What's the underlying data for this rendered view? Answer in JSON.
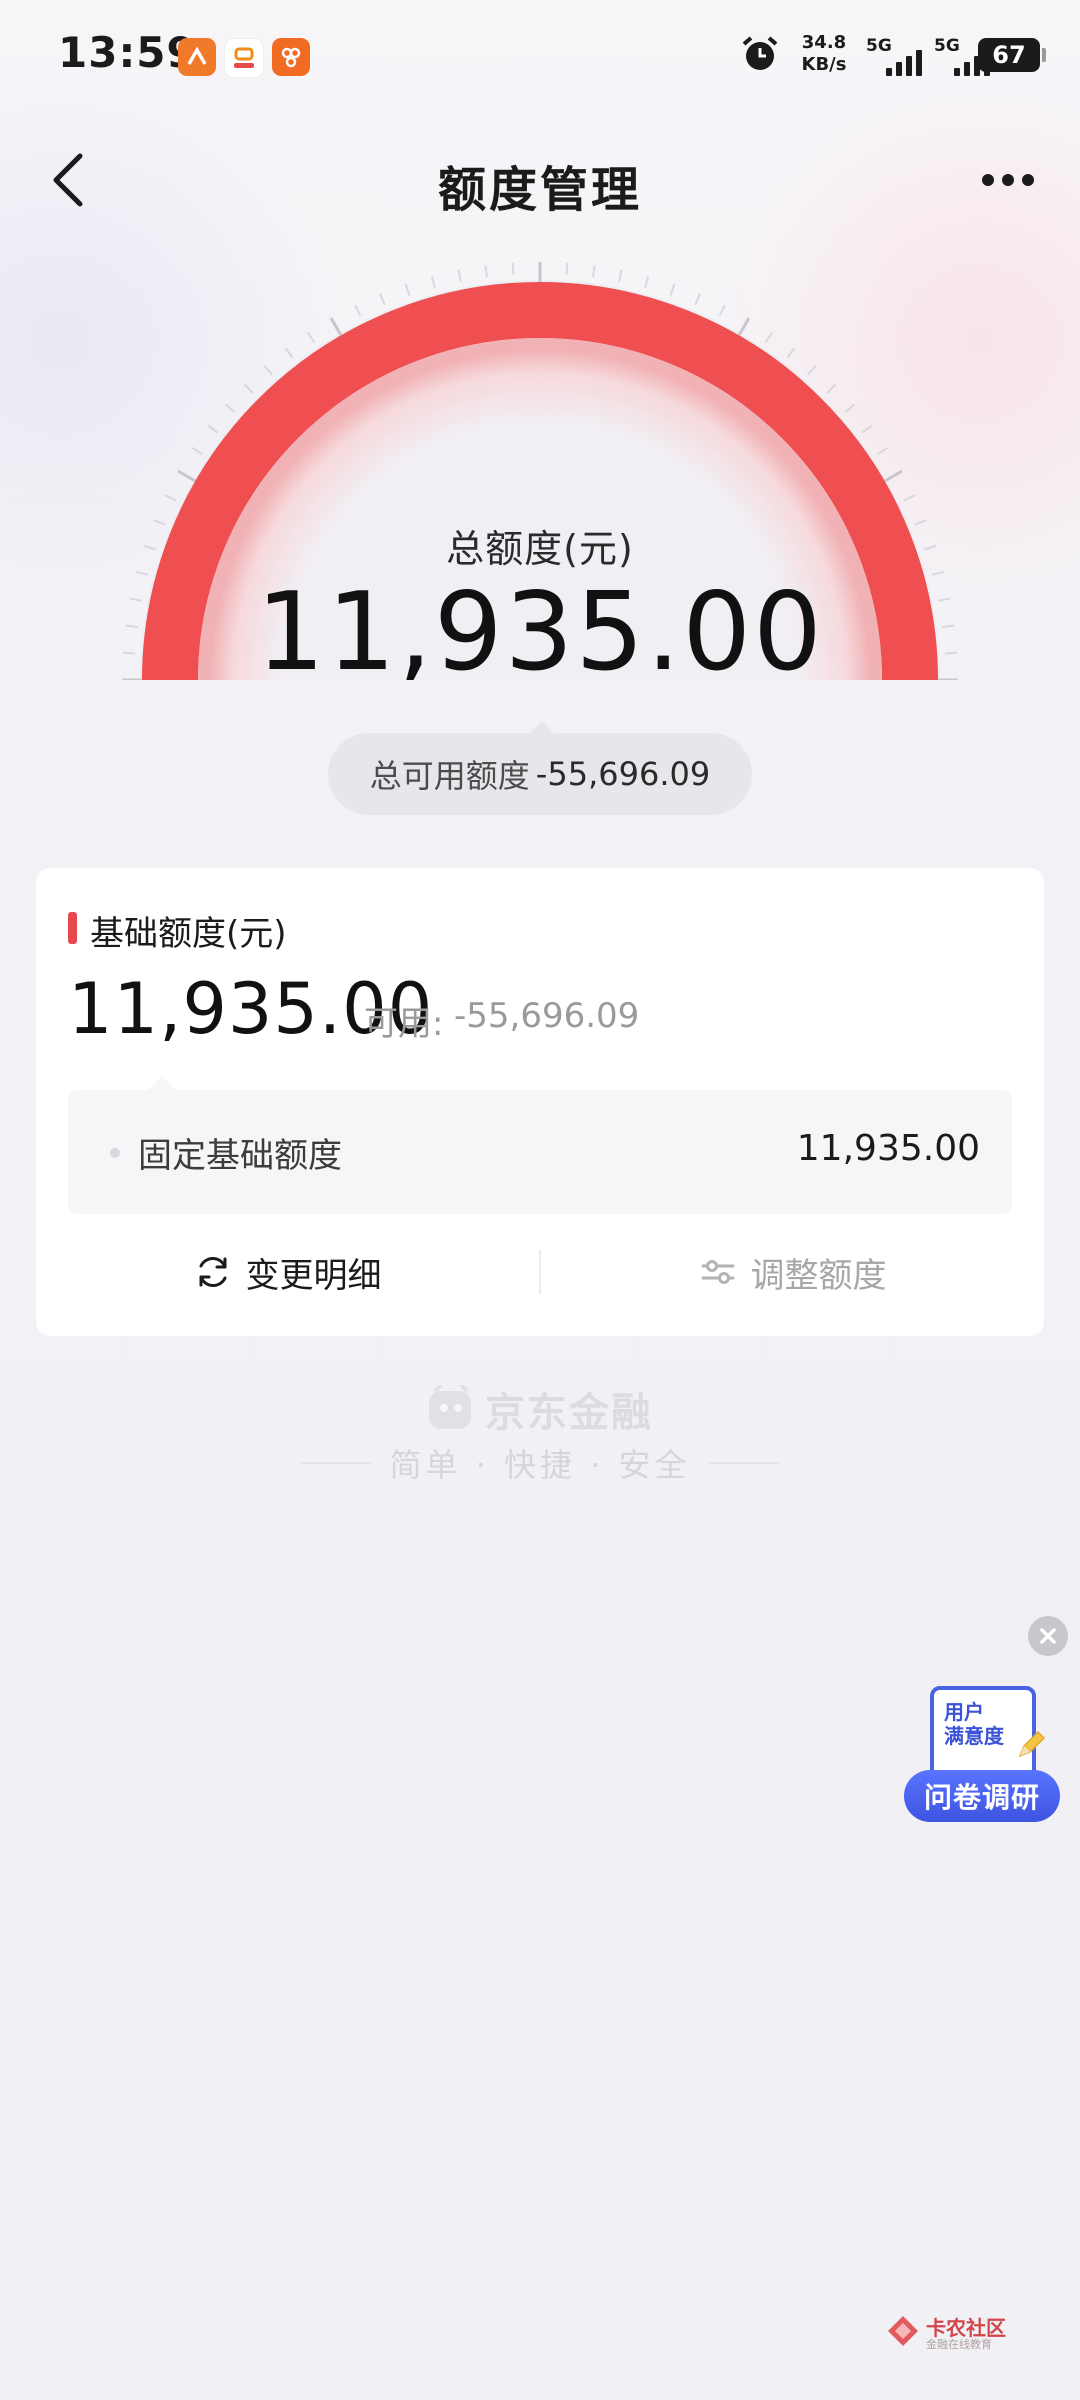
{
  "status_bar": {
    "time": "13:59",
    "net_speed_value": "34.8",
    "net_speed_unit": "KB/s",
    "sim1_label": "5G",
    "sim2_label": "5G",
    "battery": "67"
  },
  "nav": {
    "title": "额度管理"
  },
  "gauge": {
    "label": "总额度(元)",
    "amount": "11,935.00",
    "fill_fraction": 1.0,
    "arc_color": "#ef4f50"
  },
  "available_pill": {
    "label": "总可用额度",
    "value": "-55,696.09"
  },
  "base_card": {
    "title": "基础额度(元)",
    "amount": "11,935.00",
    "available_label": "可用:",
    "available_value": "-55,696.09",
    "detail": {
      "label": "固定基础额度",
      "value": "11,935.00"
    },
    "actions": {
      "change_detail": "变更明细",
      "adjust_limit": "调整额度"
    }
  },
  "brand": {
    "name": "京东金融",
    "slogan": "简单 · 快捷 · 安全"
  },
  "survey": {
    "doc_title_line1": "用户",
    "doc_title_line2": "满意度",
    "button": "问卷调研"
  },
  "watermark": {
    "name": "卡农社区",
    "sub": "金融在线教育"
  },
  "colors": {
    "accent_red": "#e8494c",
    "survey_blue": "#4a63e6"
  }
}
